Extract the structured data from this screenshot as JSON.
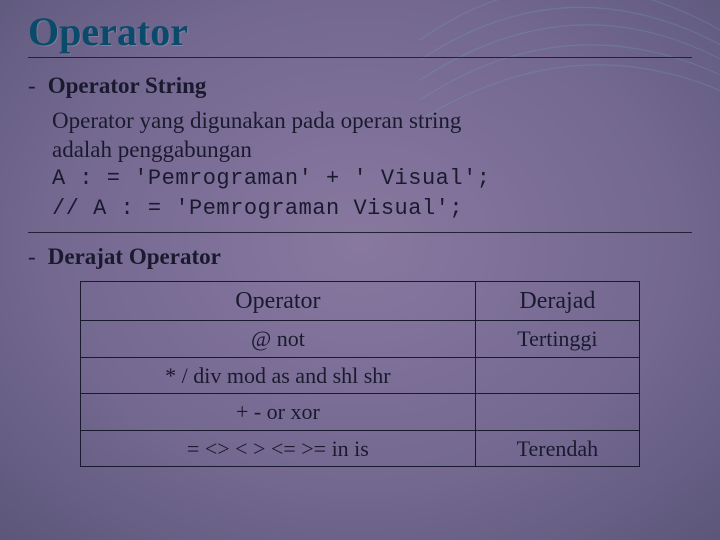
{
  "title": "Operator",
  "section1": {
    "heading": "Operator String",
    "desc_line1": "Operator yang digunakan pada operan string",
    "desc_line2": "adalah penggabungan",
    "code_line1": "A : = 'Pemrograman' + ' Visual';",
    "code_line2": "// A : = 'Pemrograman Visual';"
  },
  "section2": {
    "heading": "Derajat Operator"
  },
  "table": {
    "headers": {
      "col1": "Operator",
      "col2": "Derajad"
    },
    "rows": [
      {
        "ops": "@ not",
        "level": "Tertinggi"
      },
      {
        "ops": "* / div mod as and shl shr",
        "level": ""
      },
      {
        "ops": "+ - or xor",
        "level": ""
      },
      {
        "ops": "= <> < > <= >= in is",
        "level": "Terendah"
      }
    ]
  }
}
